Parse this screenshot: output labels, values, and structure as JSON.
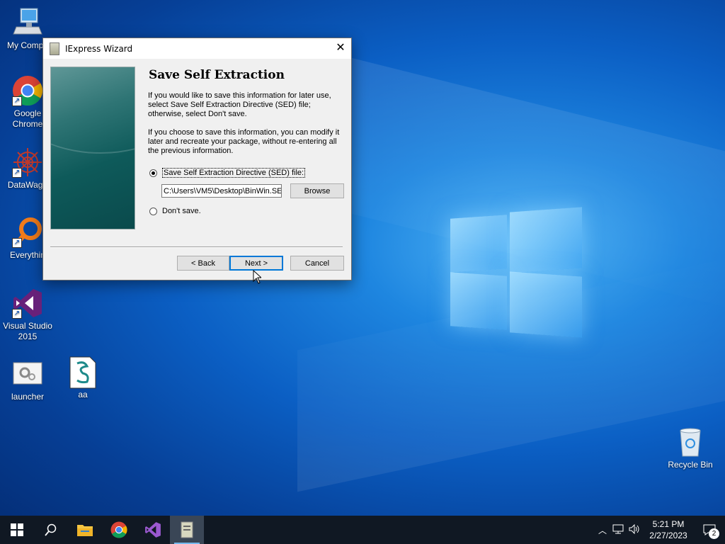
{
  "desktop": {
    "icons": [
      {
        "label": "My Compu"
      },
      {
        "label": "Google Chrome"
      },
      {
        "label": "DataWago"
      },
      {
        "label": "Everythin"
      },
      {
        "label": "Visual Studio 2015"
      },
      {
        "label": "launcher"
      },
      {
        "label": "aa"
      },
      {
        "label": "Recycle Bin"
      }
    ]
  },
  "dialog": {
    "title": "IExpress Wizard",
    "heading": "Save Self Extraction Directive",
    "para1": "If you would like to save this information for later use, select Save Self Extraction Directive (SED) file; otherwise, select Don't save.",
    "para2": "If you choose to save this information, you can modify it later and recreate your package, without re-entering all the previous information.",
    "radio_save_label": "Save Self Extraction Directive (SED) file:",
    "path_value": "C:\\Users\\VM5\\Desktop\\BinWin.SE",
    "browse_label": "Browse",
    "radio_dont_label": "Don't save.",
    "back_label": "< Back",
    "next_label": "Next >",
    "cancel_label": "Cancel",
    "selected_option": "save"
  },
  "taskbar": {
    "time": "5:21 PM",
    "date": "2/27/2023",
    "notification_count": "2"
  }
}
